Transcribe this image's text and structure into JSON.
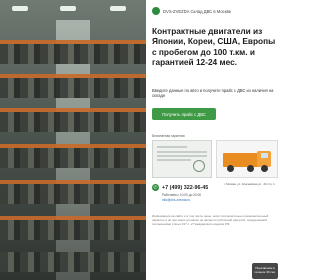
{
  "brand": {
    "text": "DVS-ZVEZDA Склад ДВС в Москве"
  },
  "hero": {
    "headline": "Контрактные двигатели из Японии, Кореи, США, Европы с пробегом до 100 т.км. и гарантией 12-24 мес.",
    "subtext": "Введите данные по авто и получите прайс с ДВС из наличия на складе",
    "cta_label": "Получить прайс с ДВС"
  },
  "cards": {
    "title": "Бесплатная гарантия"
  },
  "contacts": {
    "phone": "+7 (499) 322-96-45",
    "address": "г. Москва, ул. Ключевская ул., 20 стр. 1",
    "hours": "Работаем с 10:00 до 20:00",
    "email": "info@dvs-zvezda.ru"
  },
  "footer": {
    "disclaimer": "Информация на сайте и в том числе цены, носит исключительно ознакомительный характер и ни при каких условиях не является публичной офертой, определяемой положениями статьи 437 п. 2 Гражданского кодекса РФ"
  },
  "widget": {
    "callback_label": "Перезвоним в течение 30 сек."
  },
  "colors": {
    "accent": "#3f9a45",
    "headline": "#1c1c1c",
    "widget_bg": "#474747"
  }
}
